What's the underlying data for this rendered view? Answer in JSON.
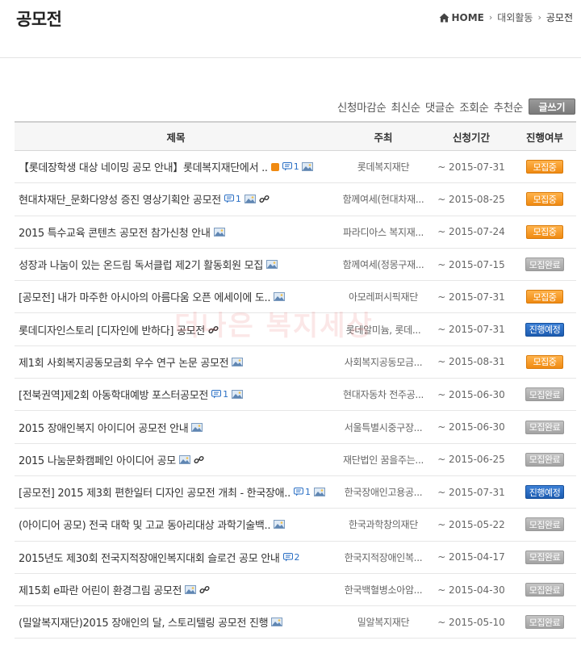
{
  "header": {
    "title": "공모전",
    "breadcrumb": {
      "home": "HOME",
      "parent": "대외활동",
      "current": "공모전"
    }
  },
  "sort": {
    "options": [
      "신청마감순",
      "최신순",
      "댓글순",
      "조회순",
      "추천순"
    ],
    "write_label": "글쓰기"
  },
  "table": {
    "columns": {
      "title": "제목",
      "org": "주최",
      "date": "신청기간",
      "status": "진행여부"
    },
    "rows": [
      {
        "title": "【롯데장학생 대상 네이밍 공모 안내】롯데복지재단에서 ..",
        "rss": true,
        "comments": "1",
        "image": true,
        "link": false,
        "org": "롯데복지재단",
        "date": "~ 2015-07-31",
        "status": "모집중",
        "status_type": "recruiting"
      },
      {
        "title": "현대차재단_문화다양성 증진 영상기획안 공모전",
        "rss": false,
        "comments": "1",
        "image": true,
        "link": true,
        "org": "함께여세(현대차재...",
        "date": "~ 2015-08-25",
        "status": "모집중",
        "status_type": "recruiting"
      },
      {
        "title": "2015 특수교육 콘텐츠 공모전 참가신청 안내",
        "rss": false,
        "comments": "",
        "image": true,
        "link": false,
        "org": "파라디아스 복지재...",
        "date": "~ 2015-07-24",
        "status": "모집중",
        "status_type": "recruiting"
      },
      {
        "title": "성장과 나눔이 있는 온드림 독서클럽 제2기 활동회원 모집",
        "rss": false,
        "comments": "",
        "image": true,
        "link": false,
        "org": "함께여세(정몽구재...",
        "date": "~ 2015-07-15",
        "status": "모집완료",
        "status_type": "closed"
      },
      {
        "title": "[공모전] 내가 마주한 아시아의 아름다움 오픈 에세이에 도..",
        "rss": false,
        "comments": "",
        "image": true,
        "link": false,
        "org": "아모레퍼시픽재단",
        "date": "~ 2015-07-31",
        "status": "모집중",
        "status_type": "recruiting"
      },
      {
        "title": "롯데디자인스토리 [디자인에 반하다] 공모전",
        "rss": false,
        "comments": "",
        "image": false,
        "link": true,
        "org": "롯데알미늄, 롯데...",
        "date": "~ 2015-07-31",
        "status": "진행예정",
        "status_type": "planned"
      },
      {
        "title": "제1회 사회복지공동모금회 우수 연구 논문 공모전",
        "rss": false,
        "comments": "",
        "image": true,
        "link": false,
        "org": "사회복지공동모금...",
        "date": "~ 2015-08-31",
        "status": "모집중",
        "status_type": "recruiting"
      },
      {
        "title": "[전북권역]제2회 아동학대예방 포스터공모전",
        "rss": false,
        "comments": "1",
        "image": true,
        "link": false,
        "org": "현대자동차 전주공...",
        "date": "~ 2015-06-30",
        "status": "모집완료",
        "status_type": "closed"
      },
      {
        "title": "2015 장애인복지 아이디어 공모전 안내",
        "rss": false,
        "comments": "",
        "image": true,
        "link": false,
        "org": "서울특별시중구장...",
        "date": "~ 2015-06-30",
        "status": "모집완료",
        "status_type": "closed"
      },
      {
        "title": "2015 나눔문화캠페인 아이디어 공모",
        "rss": false,
        "comments": "",
        "image": true,
        "link": true,
        "org": "재단법인 꿈을주는...",
        "date": "~ 2015-06-25",
        "status": "모집완료",
        "status_type": "closed"
      },
      {
        "title": "[공모전] 2015 제3회 편한일터 디자인 공모전 개최 - 한국장애..",
        "rss": false,
        "comments": "1",
        "image": true,
        "link": false,
        "org": "한국장애인고용공...",
        "date": "~ 2015-07-31",
        "status": "진행예정",
        "status_type": "planned"
      },
      {
        "title": "(아이디어 공모) 전국 대학 및 고교 동아리대상 과학기술백..",
        "rss": false,
        "comments": "",
        "image": true,
        "link": false,
        "org": "한국과학창의재단",
        "date": "~ 2015-05-22",
        "status": "모집완료",
        "status_type": "closed"
      },
      {
        "title": "2015년도 제30회 전국지적장애인복지대회 슬로건 공모 안내",
        "rss": false,
        "comments": "2",
        "image": false,
        "link": false,
        "org": "한국지적장애인복...",
        "date": "~ 2015-04-17",
        "status": "모집완료",
        "status_type": "closed"
      },
      {
        "title": "제15회 e파란 어린이 환경그림 공모전",
        "rss": false,
        "comments": "",
        "image": true,
        "link": true,
        "org": "한국백혈병소아암...",
        "date": "~ 2015-04-30",
        "status": "모집완료",
        "status_type": "closed"
      },
      {
        "title": "(밀알복지재단)2015 장애인의 달, 스토리텔링 공모전 진행",
        "rss": false,
        "comments": "",
        "image": true,
        "link": false,
        "org": "밀알복지재단",
        "date": "~ 2015-05-10",
        "status": "모집완료",
        "status_type": "closed"
      }
    ]
  },
  "watermark": "더나은 복지세상",
  "colors": {
    "recruiting": "#f08a12",
    "closed": "#a3a3a3",
    "planned": "#1d5cb0",
    "comment": "#2a6fc4"
  }
}
